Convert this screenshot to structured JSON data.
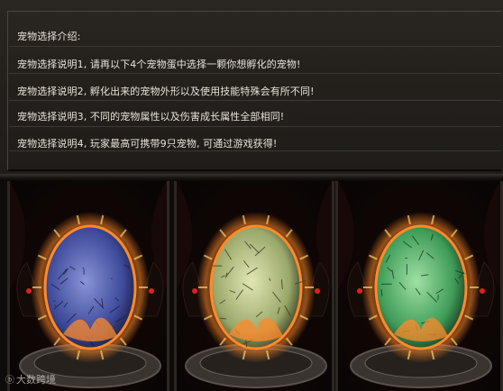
{
  "intro": {
    "heading": "宠物选择介绍:",
    "lines": [
      "宠物选择说明1, 请再以下4个宠物蛋中选择一颗你想孵化的宠物!",
      "宠物选择说明2, 孵化出来的宠物外形以及使用技能特殊会有所不同!",
      "宠物选择说明3, 不同的宠物属性以及伤害成长属性全部相同!",
      "宠物选择说明4, 玩家最高可携带9只宠物, 可通过游戏获得!"
    ]
  },
  "eggs": [
    {
      "name": "blue-egg",
      "shell": "#3d4a9a",
      "shell_light": "#8a93d8",
      "crack": "#1a1d3a"
    },
    {
      "name": "yellow-green-egg",
      "shell": "#9aa86a",
      "shell_light": "#e2e6b4",
      "crack": "#3a3d22"
    },
    {
      "name": "green-egg",
      "shell": "#3f9c58",
      "shell_light": "#9fe0a4",
      "crack": "#1a3a22"
    }
  ],
  "colors": {
    "fire": "#ff8a2a",
    "fire_glow": "#ffcf6a",
    "dragon_eye": "#e0201a"
  },
  "watermark": {
    "logo": "ⓑ",
    "text": "大数跨境"
  }
}
